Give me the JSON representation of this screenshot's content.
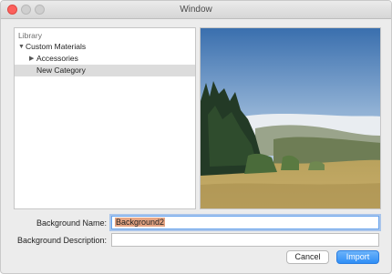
{
  "window": {
    "title": "Window"
  },
  "library": {
    "header": "Library",
    "tree": [
      {
        "label": "Custom Materials",
        "expanded": true,
        "disclosure": "▼"
      },
      {
        "label": "Accessories",
        "expanded": false,
        "disclosure": "▶"
      },
      {
        "label": "New Category",
        "selected": true
      }
    ]
  },
  "preview": {
    "image": "landscape-photo"
  },
  "form": {
    "name_label": "Background Name:",
    "name_value": "Background2",
    "description_label": "Background Description:",
    "description_value": ""
  },
  "buttons": {
    "cancel": "Cancel",
    "import": "Import"
  },
  "colors": {
    "accent": "#2f8ef6",
    "selection": "#dcdcdc",
    "text_highlight": "#e6a584",
    "close_button": "#fc605c"
  }
}
